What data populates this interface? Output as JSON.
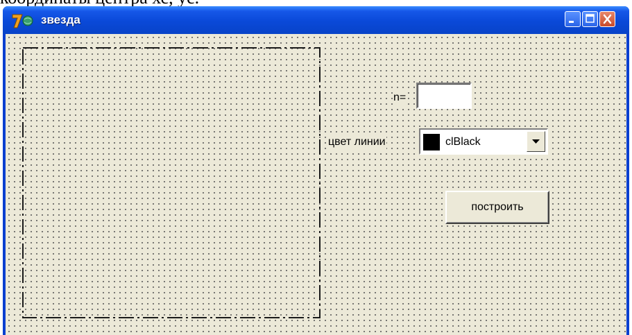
{
  "above_text": "координаты центра хс, ус.",
  "window": {
    "title": "звезда"
  },
  "form": {
    "n_label": "n=",
    "n_value": "",
    "color_label": "цвет линии",
    "color_value": "clBlack",
    "swatch_color": "#000000",
    "build_button": "построить"
  },
  "icons": {
    "app": "delphi-7-icon",
    "minimize": "minimize-icon",
    "maximize": "maximize-icon",
    "close": "close-icon",
    "dropdown": "chevron-down-icon"
  }
}
